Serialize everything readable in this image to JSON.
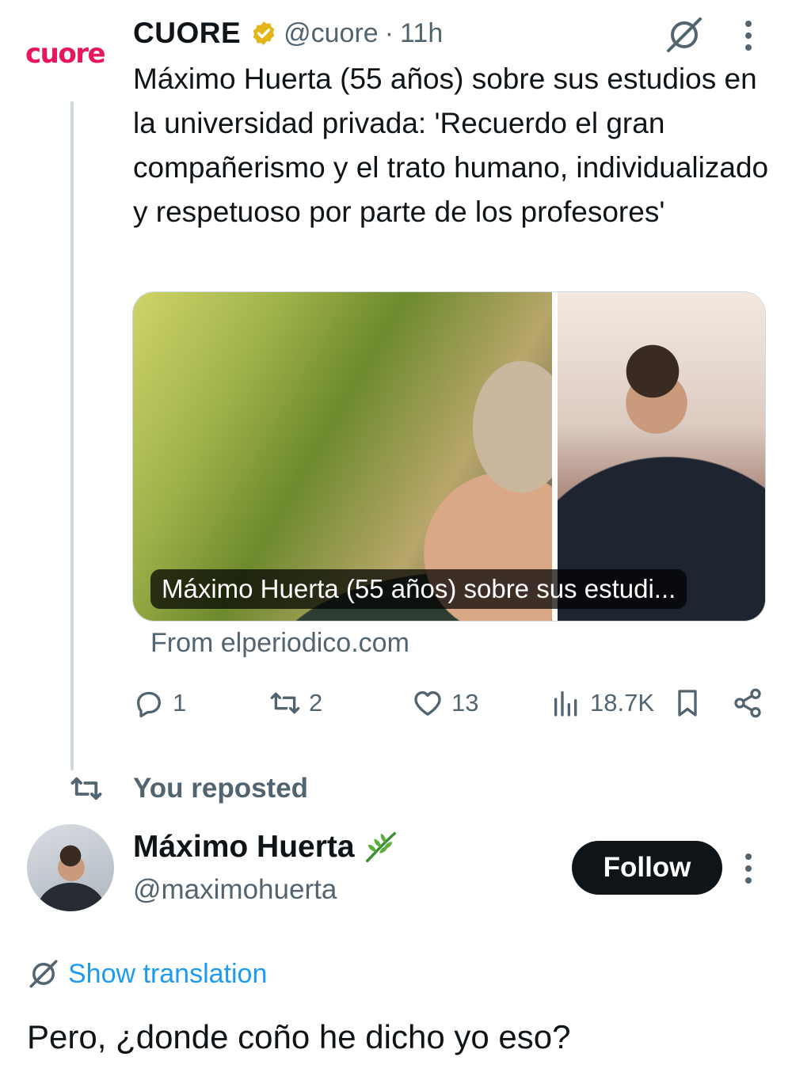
{
  "quoted_tweet": {
    "logo_text": "cuore",
    "author_name": "CUORE",
    "handle": "@cuore",
    "separator": "·",
    "time": "11h",
    "text": "Máximo Huerta (55 años) sobre sus estudios en la universidad privada: 'Recuerdo el gran compañerismo y el trato humano, individualizado y respetuoso por parte de los profesores'",
    "card": {
      "caption": "Máximo Huerta (55 años) sobre sus estudi...",
      "source": "From elperiodico.com"
    },
    "metrics": {
      "replies": "1",
      "reposts": "2",
      "likes": "13",
      "views": "18.7K"
    }
  },
  "repost_banner": {
    "label": "You reposted"
  },
  "reply_tweet": {
    "author_name": "Máximo Huerta",
    "handle": "@maximohuerta",
    "follow_label": "Follow",
    "translate_label": "Show translation",
    "text": "Pero, ¿donde coño he dicho yo eso?"
  },
  "icons": {
    "verified": "verified-badge-icon",
    "grok": "grok-icon",
    "more": "more-vertical-icon",
    "reply": "reply-icon",
    "repost": "repost-icon",
    "like": "heart-icon",
    "views": "views-icon",
    "bookmark": "bookmark-icon",
    "share": "share-icon",
    "leaf": "leaf-icon",
    "translate": "translate-icon"
  },
  "colors": {
    "text_primary": "#0f1419",
    "text_secondary": "#536471",
    "accent_link": "#1d9bf0",
    "brand_logo": "#e8175d",
    "verified_gold": "#e2b719",
    "thread_line": "#cfd9de"
  }
}
